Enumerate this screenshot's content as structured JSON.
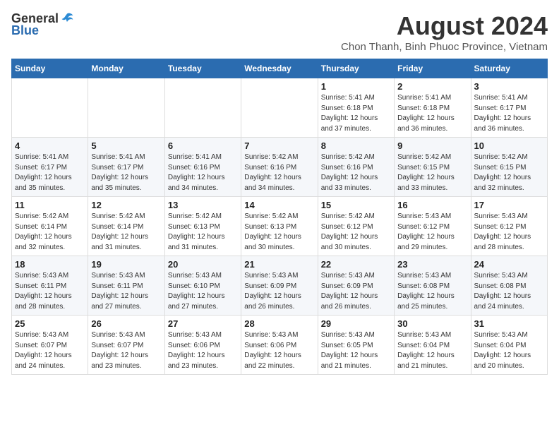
{
  "logo": {
    "general": "General",
    "blue": "Blue"
  },
  "title": {
    "month_year": "August 2024",
    "location": "Chon Thanh, Binh Phuoc Province, Vietnam"
  },
  "headers": [
    "Sunday",
    "Monday",
    "Tuesday",
    "Wednesday",
    "Thursday",
    "Friday",
    "Saturday"
  ],
  "weeks": [
    [
      {
        "day": "",
        "info": ""
      },
      {
        "day": "",
        "info": ""
      },
      {
        "day": "",
        "info": ""
      },
      {
        "day": "",
        "info": ""
      },
      {
        "day": "1",
        "info": "Sunrise: 5:41 AM\nSunset: 6:18 PM\nDaylight: 12 hours\nand 37 minutes."
      },
      {
        "day": "2",
        "info": "Sunrise: 5:41 AM\nSunset: 6:18 PM\nDaylight: 12 hours\nand 36 minutes."
      },
      {
        "day": "3",
        "info": "Sunrise: 5:41 AM\nSunset: 6:17 PM\nDaylight: 12 hours\nand 36 minutes."
      }
    ],
    [
      {
        "day": "4",
        "info": "Sunrise: 5:41 AM\nSunset: 6:17 PM\nDaylight: 12 hours\nand 35 minutes."
      },
      {
        "day": "5",
        "info": "Sunrise: 5:41 AM\nSunset: 6:17 PM\nDaylight: 12 hours\nand 35 minutes."
      },
      {
        "day": "6",
        "info": "Sunrise: 5:41 AM\nSunset: 6:16 PM\nDaylight: 12 hours\nand 34 minutes."
      },
      {
        "day": "7",
        "info": "Sunrise: 5:42 AM\nSunset: 6:16 PM\nDaylight: 12 hours\nand 34 minutes."
      },
      {
        "day": "8",
        "info": "Sunrise: 5:42 AM\nSunset: 6:16 PM\nDaylight: 12 hours\nand 33 minutes."
      },
      {
        "day": "9",
        "info": "Sunrise: 5:42 AM\nSunset: 6:15 PM\nDaylight: 12 hours\nand 33 minutes."
      },
      {
        "day": "10",
        "info": "Sunrise: 5:42 AM\nSunset: 6:15 PM\nDaylight: 12 hours\nand 32 minutes."
      }
    ],
    [
      {
        "day": "11",
        "info": "Sunrise: 5:42 AM\nSunset: 6:14 PM\nDaylight: 12 hours\nand 32 minutes."
      },
      {
        "day": "12",
        "info": "Sunrise: 5:42 AM\nSunset: 6:14 PM\nDaylight: 12 hours\nand 31 minutes."
      },
      {
        "day": "13",
        "info": "Sunrise: 5:42 AM\nSunset: 6:13 PM\nDaylight: 12 hours\nand 31 minutes."
      },
      {
        "day": "14",
        "info": "Sunrise: 5:42 AM\nSunset: 6:13 PM\nDaylight: 12 hours\nand 30 minutes."
      },
      {
        "day": "15",
        "info": "Sunrise: 5:42 AM\nSunset: 6:12 PM\nDaylight: 12 hours\nand 30 minutes."
      },
      {
        "day": "16",
        "info": "Sunrise: 5:43 AM\nSunset: 6:12 PM\nDaylight: 12 hours\nand 29 minutes."
      },
      {
        "day": "17",
        "info": "Sunrise: 5:43 AM\nSunset: 6:12 PM\nDaylight: 12 hours\nand 28 minutes."
      }
    ],
    [
      {
        "day": "18",
        "info": "Sunrise: 5:43 AM\nSunset: 6:11 PM\nDaylight: 12 hours\nand 28 minutes."
      },
      {
        "day": "19",
        "info": "Sunrise: 5:43 AM\nSunset: 6:11 PM\nDaylight: 12 hours\nand 27 minutes."
      },
      {
        "day": "20",
        "info": "Sunrise: 5:43 AM\nSunset: 6:10 PM\nDaylight: 12 hours\nand 27 minutes."
      },
      {
        "day": "21",
        "info": "Sunrise: 5:43 AM\nSunset: 6:09 PM\nDaylight: 12 hours\nand 26 minutes."
      },
      {
        "day": "22",
        "info": "Sunrise: 5:43 AM\nSunset: 6:09 PM\nDaylight: 12 hours\nand 26 minutes."
      },
      {
        "day": "23",
        "info": "Sunrise: 5:43 AM\nSunset: 6:08 PM\nDaylight: 12 hours\nand 25 minutes."
      },
      {
        "day": "24",
        "info": "Sunrise: 5:43 AM\nSunset: 6:08 PM\nDaylight: 12 hours\nand 24 minutes."
      }
    ],
    [
      {
        "day": "25",
        "info": "Sunrise: 5:43 AM\nSunset: 6:07 PM\nDaylight: 12 hours\nand 24 minutes."
      },
      {
        "day": "26",
        "info": "Sunrise: 5:43 AM\nSunset: 6:07 PM\nDaylight: 12 hours\nand 23 minutes."
      },
      {
        "day": "27",
        "info": "Sunrise: 5:43 AM\nSunset: 6:06 PM\nDaylight: 12 hours\nand 23 minutes."
      },
      {
        "day": "28",
        "info": "Sunrise: 5:43 AM\nSunset: 6:06 PM\nDaylight: 12 hours\nand 22 minutes."
      },
      {
        "day": "29",
        "info": "Sunrise: 5:43 AM\nSunset: 6:05 PM\nDaylight: 12 hours\nand 21 minutes."
      },
      {
        "day": "30",
        "info": "Sunrise: 5:43 AM\nSunset: 6:04 PM\nDaylight: 12 hours\nand 21 minutes."
      },
      {
        "day": "31",
        "info": "Sunrise: 5:43 AM\nSunset: 6:04 PM\nDaylight: 12 hours\nand 20 minutes."
      }
    ]
  ]
}
